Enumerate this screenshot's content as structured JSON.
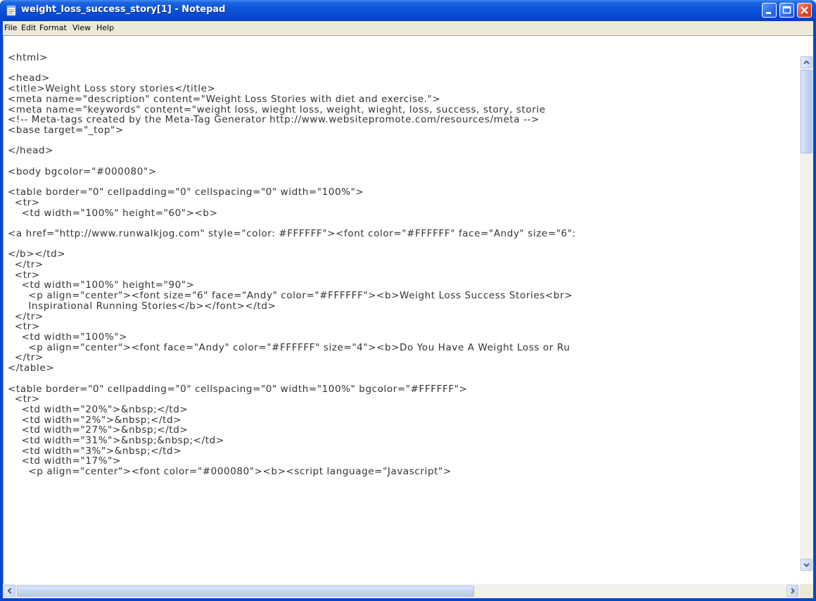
{
  "window": {
    "title": "weight_loss_success_story[1] - Notepad"
  },
  "menu": {
    "file": "File",
    "edit": "Edit",
    "format": "Format",
    "view": "View",
    "help": "Help"
  },
  "editor": {
    "lines": [
      "<html>",
      "",
      "<head>",
      "<title>Weight Loss story stories</title>",
      "<meta name=\"description\" content=\"Weight Loss Stories with diet and exercise.\">",
      "<meta name=\"keywords\" content=\"weight loss, wieght loss, weight, wieght, loss, success, story, storie",
      "<!-- Meta-tags created by the Meta-Tag Generator http://www.websitepromote.com/resources/meta -->",
      "<base target=\"_top\">",
      "",
      "</head>",
      "",
      "<body bgcolor=\"#000080\">",
      "",
      "<table border=\"0\" cellpadding=\"0\" cellspacing=\"0\" width=\"100%\">",
      "  <tr>",
      "    <td width=\"100%\" height=\"60\"><b>",
      "",
      "<a href=\"http://www.runwalkjog.com\" style=\"color: #FFFFFF\"><font color=\"#FFFFFF\" face=\"Andy\" size=\"6\":",
      "",
      "</b></td>",
      "  </tr>",
      "  <tr>",
      "    <td width=\"100%\" height=\"90\">",
      "      <p align=\"center\"><font size=\"6\" face=\"Andy\" color=\"#FFFFFF\"><b>Weight Loss Success Stories<br>",
      "      Inspirational Running Stories</b></font></td>",
      "  </tr>",
      "  <tr>",
      "    <td width=\"100%\">",
      "      <p align=\"center\"><font face=\"Andy\" color=\"#FFFFFF\" size=\"4\"><b>Do You Have A Weight Loss or Ru",
      "  </tr>",
      "</table>",
      "",
      "<table border=\"0\" cellpadding=\"0\" cellspacing=\"0\" width=\"100%\" bgcolor=\"#FFFFFF\">",
      "  <tr>",
      "    <td width=\"20%\">&nbsp;</td>",
      "    <td width=\"2%\">&nbsp;</td>",
      "    <td width=\"27%\">&nbsp;</td>",
      "    <td width=\"31%\">&nbsp;&nbsp;</td>",
      "    <td width=\"3%\">&nbsp;</td>",
      "    <td width=\"17%\">",
      "      <p align=\"center\"><font color=\"#000080\"><b><script language=\"Javascript\">"
    ]
  }
}
